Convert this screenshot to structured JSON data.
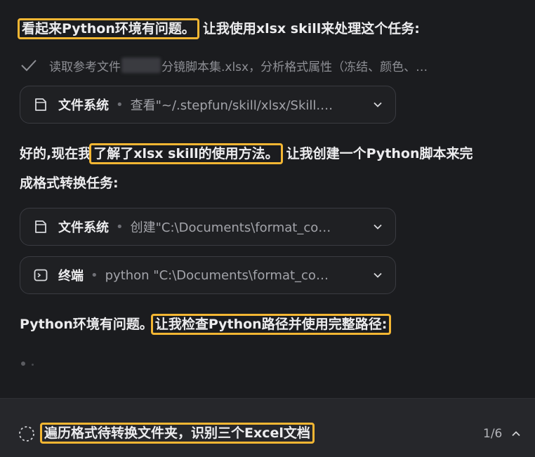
{
  "messages": {
    "m1_hl": "看起来Python环境有问题。",
    "m1_rest": "让我使用xlsx skill来处理这个任务:",
    "m2_pre": "好的,现在我",
    "m2_hl": "了解了xlsx skill的使用方法。",
    "m2_rest_l1": "让我创建一个Python脚本来完",
    "m2_l2": "成格式转换任务:",
    "m3_pre": "Python环境有问题。",
    "m3_hl": "让我检查Python路径并使用完整路径:"
  },
  "completed_step": {
    "text_before": "读取参考文件",
    "text_after": "分镜脚本集.xlsx，分析格式属性（冻结、颜色、…",
    "icon": "check-icon"
  },
  "tools": [
    {
      "name": "文件系统",
      "detail": "查看\"~/.stepfun/skill/xlsx/Skill.…",
      "icon": "file-icon"
    },
    {
      "name": "文件系统",
      "detail": "创建\"C:\\Documents\\format_co…",
      "icon": "file-icon"
    },
    {
      "name": "终端",
      "detail": "python \"C:\\Documents\\format_co…",
      "icon": "terminal-icon"
    }
  ],
  "footer": {
    "task": "遍历格式待转换文件夹，识别三个Excel文档",
    "counter": "1/6"
  },
  "colors": {
    "background": "#1b1c1f",
    "highlight": "#f3b633",
    "footer_bg": "#26272b"
  }
}
